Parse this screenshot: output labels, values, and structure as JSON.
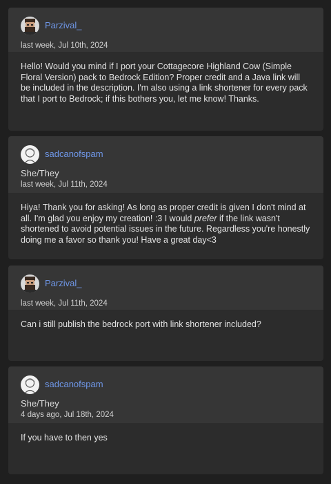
{
  "posts": [
    {
      "username": "Parzival_",
      "avatar_icon": "bearded-man-avatar-icon",
      "timestamp": "last week, Jul 10th, 2024",
      "body": "Hello! Would you mind if I port your Cottagecore Highland Cow (Simple Floral Version) pack to Bedrock Edition? Proper credit and a Java link will be included in the description. I'm also using a link shortener for every pack that I port to Bedrock; if this bothers you, let me know! Thanks."
    },
    {
      "username": "sadcanofspam",
      "avatar_icon": "sketch-portrait-avatar-icon",
      "pronouns": "She/They",
      "timestamp": "last week, Jul 11th, 2024",
      "body_before": "Hiya! Thank you for asking! As long as proper credit is given I don't mind at all. I'm glad you enjoy my creation! :3 I would ",
      "body_emphasis": "prefer",
      "body_after": " if the link wasn't shortened to avoid potential issues in the future. Regardless you're honestly doing me a favor so thank you! Have a great day<3"
    },
    {
      "username": "Parzival_",
      "avatar_icon": "bearded-man-avatar-icon",
      "timestamp": "last week, Jul 11th, 2024",
      "body": "Can i still publish the bedrock port with link shortener included?"
    },
    {
      "username": "sadcanofspam",
      "avatar_icon": "sketch-portrait-avatar-icon",
      "pronouns": "She/They",
      "timestamp": "4 days ago, Jul 18th, 2024",
      "body": "If you have to then yes"
    }
  ],
  "colors": {
    "page_background": "#1f1f1f",
    "card_background": "#2c2c2c",
    "header_background": "#363636",
    "username": "#6f97e8"
  }
}
